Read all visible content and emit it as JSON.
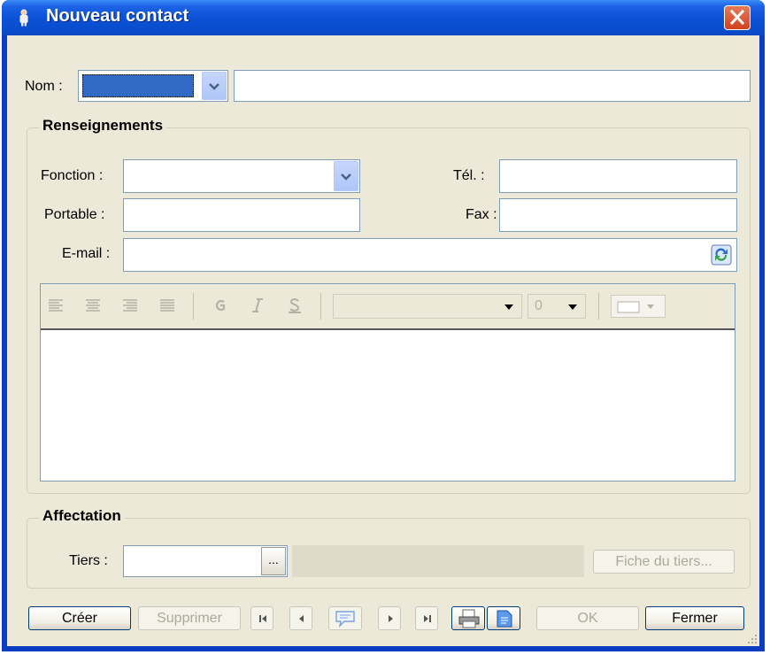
{
  "window": {
    "title": "Nouveau contact"
  },
  "nom": {
    "label": "Nom :",
    "civility_value": "",
    "name_value": ""
  },
  "renseignements": {
    "title": "Renseignements",
    "fonction_label": "Fonction :",
    "tel_label": "Tél. :",
    "portable_label": "Portable :",
    "fax_label": "Fax :",
    "email_label": "E-mail :",
    "font_size_value": "0"
  },
  "affectation": {
    "title": "Affectation",
    "tiers_label": "Tiers :",
    "browse_label": "...",
    "fiche_button": "Fiche du tiers..."
  },
  "footer": {
    "create": "Créer",
    "delete": "Supprimer",
    "ok": "OK",
    "close": "Fermer"
  },
  "colors": {
    "titlebar": "#0a4dcf",
    "face": "#ece9d8",
    "selection": "#316ac5"
  }
}
